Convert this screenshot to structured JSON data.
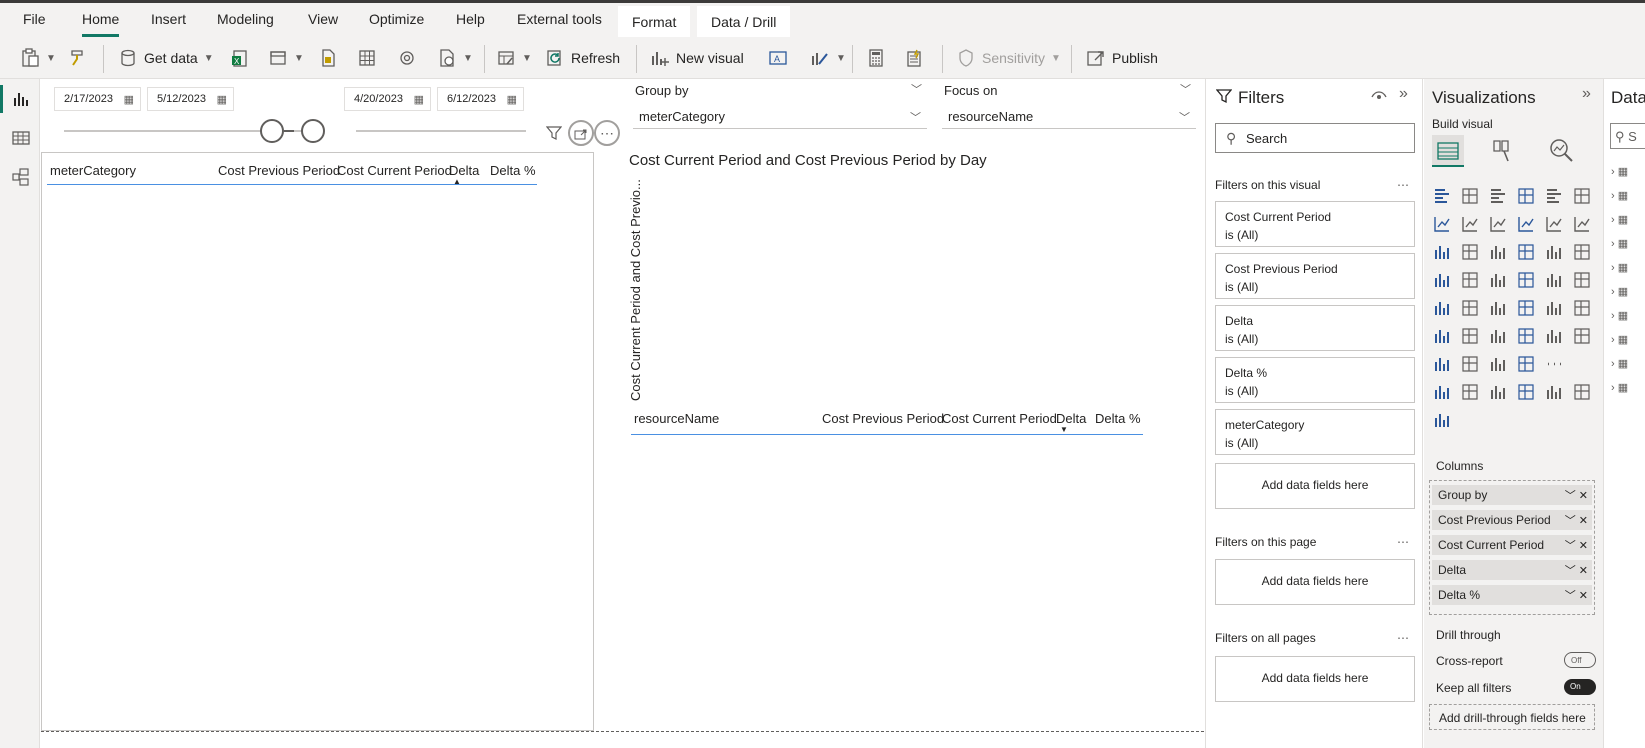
{
  "menu": {
    "tabs": [
      {
        "label": "File"
      },
      {
        "label": "Home"
      },
      {
        "label": "Insert"
      },
      {
        "label": "Modeling"
      },
      {
        "label": "View"
      },
      {
        "label": "Optimize"
      },
      {
        "label": "Help"
      },
      {
        "label": "External tools"
      },
      {
        "label": "Format"
      },
      {
        "label": "Data / Drill"
      }
    ],
    "active_tab": "Home"
  },
  "ribbon": {
    "get_data": "Get data",
    "refresh": "Refresh",
    "new_visual": "New visual",
    "sensitivity": "Sensitivity",
    "publish": "Publish"
  },
  "slicers": {
    "previous_start": "2/17/2023",
    "previous_end": "5/12/2023",
    "current_start": "4/20/2023",
    "current_end": "6/12/2023"
  },
  "group_by": {
    "label": "Group by",
    "value": "meterCategory"
  },
  "focus_on": {
    "label": "Focus on",
    "value": "resourceName"
  },
  "left_table": {
    "columns": [
      "meterCategory",
      "Cost Previous Period",
      "Cost Current Period",
      "Delta",
      "Delta %"
    ]
  },
  "chart": {
    "title": "Cost Current Period and Cost Previous Period by Day",
    "y_label": "Cost Current Period and Cost Previo..."
  },
  "right_table": {
    "columns": [
      "resourceName",
      "Cost Previous Period",
      "Cost Current Period",
      "Delta",
      "Delta %"
    ]
  },
  "filters": {
    "title": "Filters",
    "search_placeholder": "Search",
    "on_visual_label": "Filters on this visual",
    "on_page_label": "Filters on this page",
    "all_pages_label": "Filters on all pages",
    "add_fields": "Add data fields here",
    "visual_filters": [
      {
        "field": "Cost Current Period",
        "state": "is (All)"
      },
      {
        "field": "Cost Previous Period",
        "state": "is (All)"
      },
      {
        "field": "Delta",
        "state": "is (All)"
      },
      {
        "field": "Delta %",
        "state": "is (All)"
      },
      {
        "field": "meterCategory",
        "state": "is (All)"
      }
    ]
  },
  "visualizations": {
    "title": "Visualizations",
    "build_visual": "Build visual",
    "columns_label": "Columns",
    "wells": [
      "Group by",
      "Cost Previous Period",
      "Cost Current Period",
      "Delta",
      "Delta %"
    ],
    "drill_through": "Drill through",
    "cross_report": "Cross-report",
    "cross_report_state": "Off",
    "keep_all_filters": "Keep all filters",
    "keep_all_filters_state": "On",
    "add_drill": "Add drill-through fields here"
  },
  "data_pane": {
    "title": "Data",
    "search_placeholder": "S"
  },
  "colors": {
    "accent": "#117865",
    "ribbon_bg": "#f3f2f1",
    "header_bar": "#3b3a39",
    "link_blue": "#4a90e2"
  }
}
